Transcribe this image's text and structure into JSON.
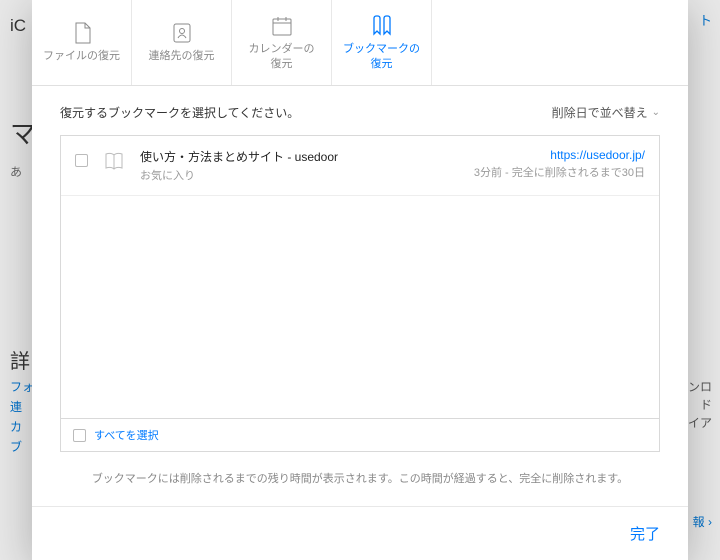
{
  "bg": {
    "brand": "iC",
    "title_char": "マ",
    "sub_char": "あ",
    "section_char": "詳",
    "links": [
      "フォ",
      "連",
      "カ",
      "ブ"
    ],
    "right_top": "ト",
    "right_list": [
      "ンロ",
      "ド",
      "イア"
    ],
    "report": "報 ›"
  },
  "tabs": [
    {
      "label": "ファイルの復元"
    },
    {
      "label": "連絡先の復元"
    },
    {
      "label": "カレンダーの\n復元"
    },
    {
      "label": "ブックマークの\n復元"
    }
  ],
  "active_tab": 3,
  "prompt": "復元するブックマークを選択してください。",
  "sort": {
    "label": "削除日で並べ替え"
  },
  "items": [
    {
      "title": "使い方・方法まとめサイト - usedoor",
      "folder": "お気に入り",
      "url": "https://usedoor.jp/",
      "time": "3分前 - 完全に削除されるまで30日"
    }
  ],
  "select_all": "すべてを選択",
  "hint": "ブックマークには削除されるまでの残り時間が表示されます。この時間が経過すると、完全に削除されます。",
  "done": "完了"
}
